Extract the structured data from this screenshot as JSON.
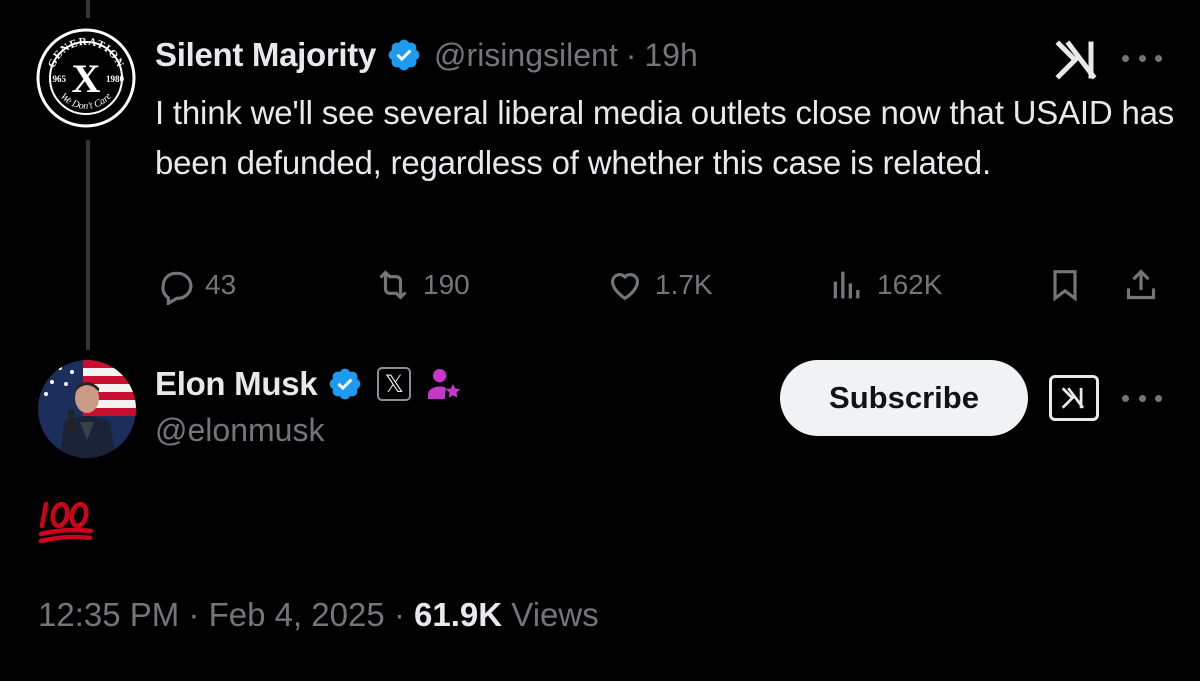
{
  "tweet1": {
    "display_name": "Silent Majority",
    "handle": "@risingsilent",
    "separator": "·",
    "time": "19h",
    "text": "I think we'll see several liberal media outlets close now that USAID has been defunded, regardless of whether this case is related.",
    "avatar": {
      "top_text": "GENERATION",
      "left_year": "1965",
      "right_year": "1980",
      "center": "X",
      "bottom_text": "We Don't Care"
    },
    "actions": {
      "replies": "43",
      "reposts": "190",
      "likes": "1.7K",
      "views": "162K"
    }
  },
  "tweet2": {
    "display_name": "Elon Musk",
    "handle": "@elonmusk",
    "affiliate_badge": "𝕏",
    "subscribe_label": "Subscribe",
    "emoji": "💯",
    "timestamp": "12:35 PM · Feb 4, 2025 · ",
    "views_count": "61.9K",
    "views_label": " Views"
  },
  "colors": {
    "background": "#000000",
    "text_primary": "#e7e9ea",
    "text_secondary": "#71767b",
    "verified_blue": "#1d9bf0",
    "affiliate_purple": "#c936cc",
    "emoji_red": "#d0021b"
  },
  "icons": [
    "reply-icon",
    "repost-icon",
    "like-icon",
    "views-icon",
    "bookmark-icon",
    "share-icon",
    "grok-icon",
    "more-icon",
    "verified-icon",
    "x-affiliate-icon",
    "subscriber-icon"
  ]
}
